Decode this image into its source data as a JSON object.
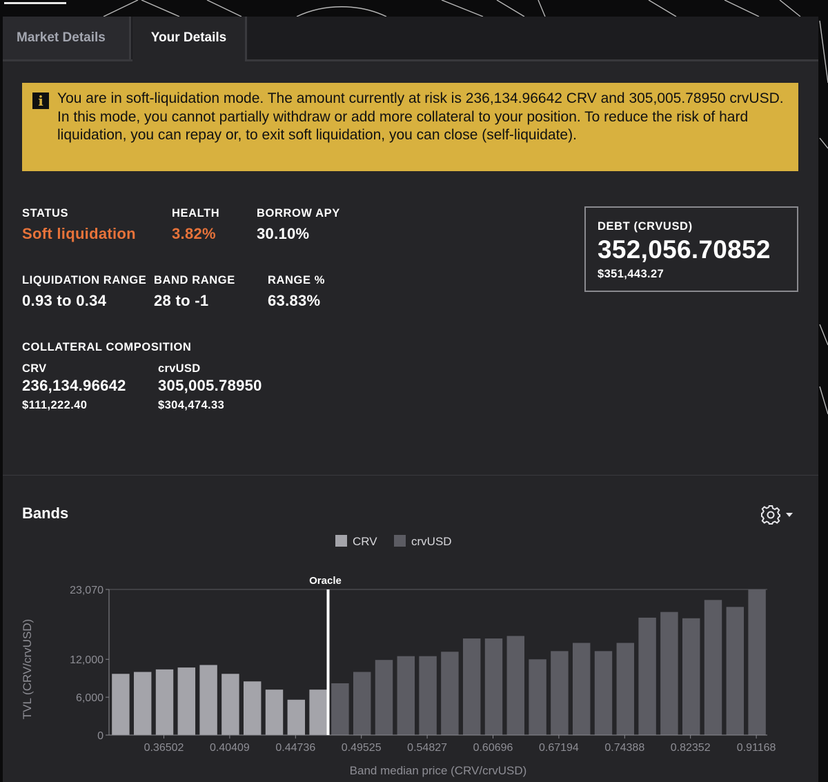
{
  "tabs": [
    {
      "label": "Market Details",
      "active": false
    },
    {
      "label": "Your Details",
      "active": true
    }
  ],
  "alert": {
    "icon": "info-icon",
    "text": "You are in soft-liquidation mode. The amount currently at risk is 236,134.96642 CRV and 305,005.78950 crvUSD. In this mode, you cannot partially withdraw or add more collateral to your position. To reduce the risk of hard liquidation, you can repay or, to exit soft liquidation, you can close (self-liquidate).",
    "color": "#d8b13f"
  },
  "stats": {
    "status": {
      "label": "STATUS",
      "value": "Soft liquidation"
    },
    "health": {
      "label": "HEALTH",
      "value": "3.82%"
    },
    "borrow_apy": {
      "label": "BORROW APY",
      "value": "30.10%"
    },
    "liquidation_range": {
      "label": "LIQUIDATION RANGE",
      "value": "0.93 to 0.34"
    },
    "band_range": {
      "label": "BAND RANGE",
      "value": "28 to -1"
    },
    "range_pct": {
      "label": "RANGE %",
      "value": "63.83%"
    },
    "warning_color": "#e8733a"
  },
  "debt": {
    "label": "DEBT (CRVUSD)",
    "value": "352,056.70852",
    "usd": "$351,443.27"
  },
  "collateral": {
    "label": "COLLATERAL COMPOSITION",
    "crv": {
      "label": "CRV",
      "value": "236,134.96642",
      "usd": "$111,222.40"
    },
    "crvusd": {
      "label": "crvUSD",
      "value": "305,005.78950",
      "usd": "$304,474.33"
    }
  },
  "bands": {
    "title": "Bands",
    "settings_icon": "gear-icon",
    "dropdown_icon": "caret-down-icon"
  },
  "chart_data": {
    "type": "bar",
    "title": "",
    "xlabel": "Band median price (CRV/crvUSD)",
    "ylabel": "TVL (CRV/crvUSD)",
    "ylim": [
      0,
      23070
    ],
    "yticks": [
      "0",
      "6,000",
      "12,000",
      "23,070"
    ],
    "ytick_values": [
      0,
      6000,
      12000,
      23070
    ],
    "xtick_labels": [
      "0.36502",
      "0.40409",
      "0.44736",
      "0.49525",
      "0.54827",
      "0.60696",
      "0.67194",
      "0.74388",
      "0.82352",
      "0.91168"
    ],
    "xtick_band_index": [
      2,
      5,
      8,
      11,
      14,
      17,
      20,
      23,
      26,
      29
    ],
    "legend": [
      {
        "name": "CRV",
        "color": "#a4a4aa"
      },
      {
        "name": "crvUSD",
        "color": "#5c5c63"
      }
    ],
    "oracle_label": "Oracle",
    "oracle_after_band_index": 9,
    "series": [
      {
        "name": "CRV",
        "color": "#a4a4aa",
        "values": [
          9700,
          10000,
          10400,
          10700,
          11100,
          9700,
          8500,
          7200,
          5600,
          7200,
          0,
          0,
          0,
          0,
          0,
          0,
          0,
          0,
          0,
          0,
          0,
          0,
          0,
          0,
          0,
          0,
          0,
          0,
          0,
          0
        ]
      },
      {
        "name": "crvUSD",
        "color": "#5c5c63",
        "values": [
          0,
          0,
          0,
          0,
          0,
          0,
          0,
          0,
          0,
          0,
          8200,
          10000,
          11900,
          12500,
          12500,
          13200,
          15300,
          15300,
          15700,
          12000,
          13300,
          14600,
          13300,
          14600,
          18600,
          19500,
          18500,
          21400,
          20300,
          23070
        ]
      }
    ]
  }
}
